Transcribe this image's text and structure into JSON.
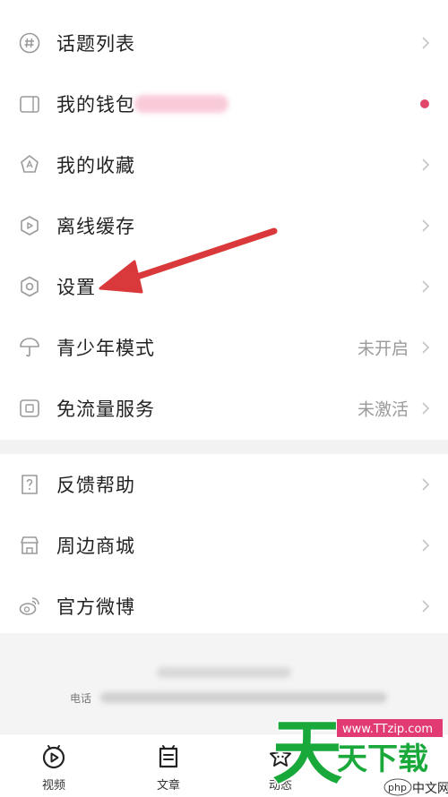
{
  "menu_group1": [
    {
      "icon": "hashtag-icon",
      "label": "话题列表"
    },
    {
      "icon": "wallet-icon",
      "label": "我的钱包",
      "has_dot": true
    },
    {
      "icon": "star-icon",
      "label": "我的收藏"
    },
    {
      "icon": "download-icon",
      "label": "离线缓存"
    },
    {
      "icon": "gear-icon",
      "label": "设置"
    },
    {
      "icon": "umbrella-icon",
      "label": "青少年模式",
      "value": "未开启"
    },
    {
      "icon": "data-plan-icon",
      "label": "免流量服务",
      "value": "未激活"
    }
  ],
  "menu_group2": [
    {
      "icon": "feedback-icon",
      "label": "反馈帮助"
    },
    {
      "icon": "store-icon",
      "label": "周边商城"
    },
    {
      "icon": "weibo-icon",
      "label": "官方微博"
    }
  ],
  "footer": {
    "phone_label": "电话"
  },
  "tabbar": [
    {
      "icon": "video-icon",
      "label": "视频"
    },
    {
      "icon": "article-icon",
      "label": "文章"
    },
    {
      "icon": "moments-icon",
      "label": "动态"
    }
  ],
  "watermark": {
    "big_char": "天",
    "small_text": "天下载",
    "url": "www.TTzip.com",
    "brand_php": "php",
    "brand_cn": "中文网"
  },
  "colors": {
    "dot": "#e0476a",
    "arrow": "#d9393b",
    "watermark_green": "#19a83a",
    "watermark_pink": "#e23a72"
  }
}
